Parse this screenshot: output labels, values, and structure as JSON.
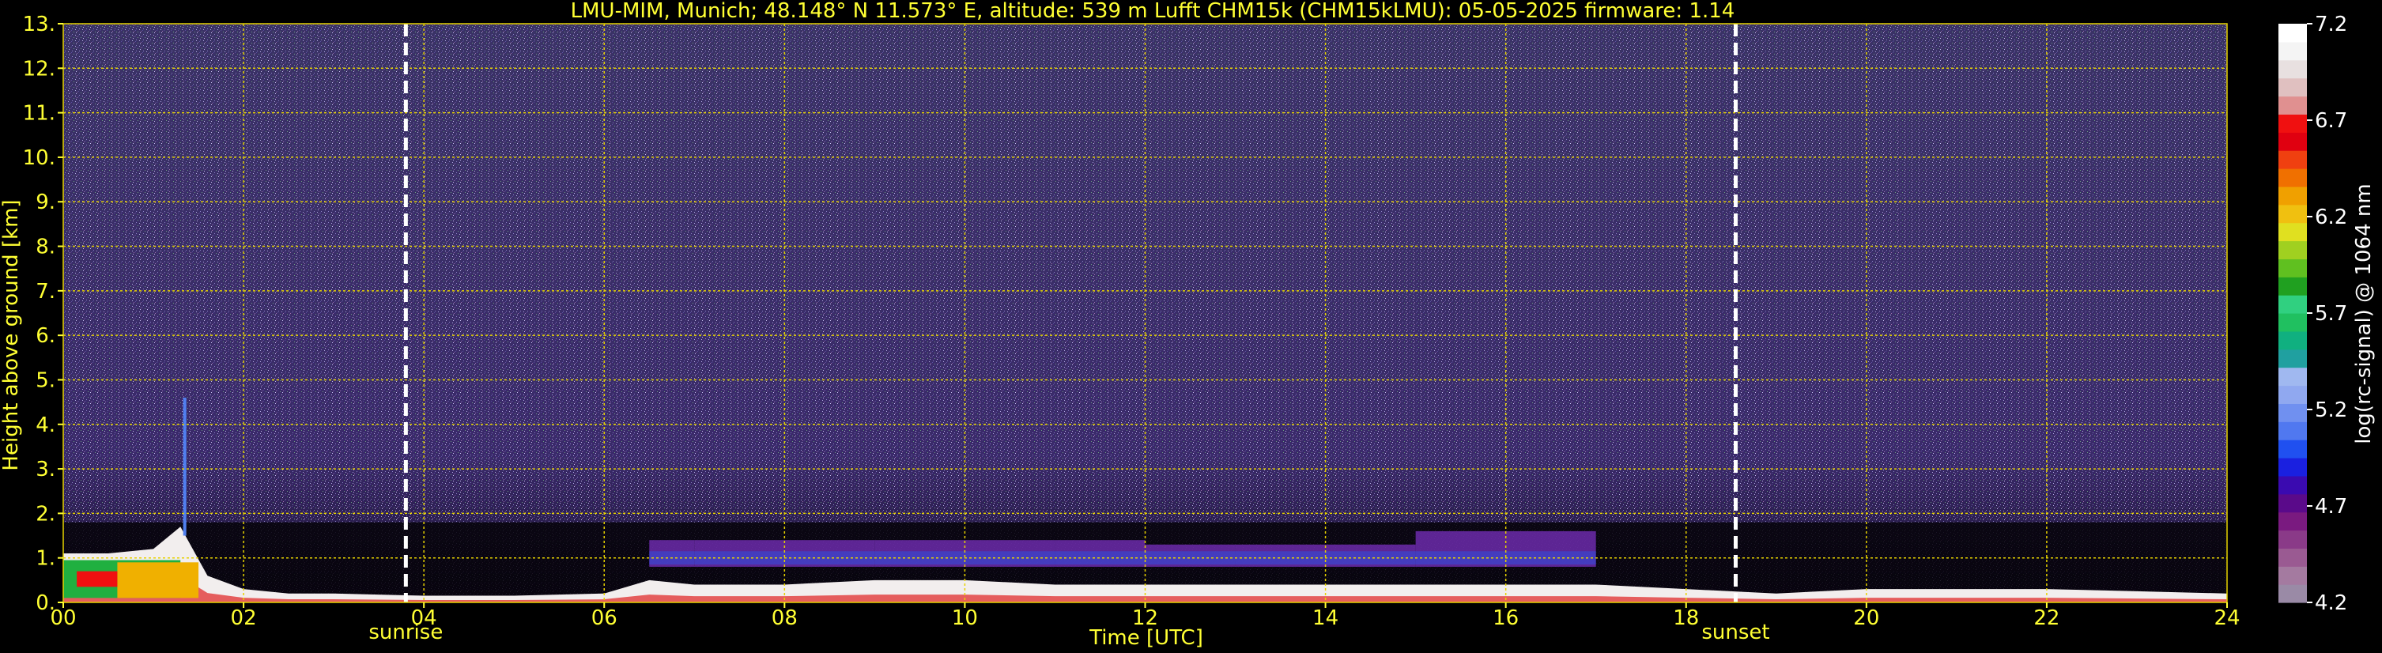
{
  "chart_data": {
    "type": "heatmap",
    "title": "LMU-MIM, Munich; 48.148° N 11.573° E, altitude: 539 m    Lufft CHM15k (CHM15kLMU): 05-05-2025    firmware: 1.14",
    "xlabel": "Time [UTC]",
    "ylabel": "Height above ground [km]",
    "xlim": [
      0,
      24
    ],
    "ylim": [
      0,
      13
    ],
    "x_ticks": [
      "00",
      "02",
      "04",
      "06",
      "08",
      "10",
      "12",
      "14",
      "16",
      "18",
      "20",
      "22",
      "24"
    ],
    "y_ticks": [
      "0.",
      "1.",
      "2.",
      "3.",
      "4.",
      "5.",
      "6.",
      "7.",
      "8.",
      "9.",
      "10.",
      "11.",
      "12.",
      "13."
    ],
    "grid": true,
    "events": [
      {
        "name": "sunrise",
        "time": 3.8
      },
      {
        "name": "sunset",
        "time": 18.55
      }
    ],
    "colorbar": {
      "label": "log(rc-signal) @ 1064 nm",
      "range": [
        4.2,
        7.2
      ],
      "ticks": [
        "4.2",
        "4.7",
        "5.2",
        "5.7",
        "6.2",
        "6.7",
        "7.2"
      ],
      "colors": [
        "#9a8aa6",
        "#a47aa0",
        "#9a5a92",
        "#8a3a88",
        "#7a1a80",
        "#5a0a8a",
        "#3a0ab0",
        "#1a20e0",
        "#2050f0",
        "#5078f0",
        "#7090f0",
        "#90a8f0",
        "#a0b8f0",
        "#20a0a0",
        "#10b080",
        "#20c060",
        "#30d080",
        "#20a020",
        "#60c020",
        "#a0d020",
        "#e0e020",
        "#f0c010",
        "#f0a000",
        "#f07000",
        "#f04010",
        "#e00010",
        "#f01010",
        "#e09090",
        "#e0c0c0",
        "#e8e0e0",
        "#f4f4f4",
        "#ffffff"
      ]
    },
    "signal_profile": {
      "description_time_hours": [
        0,
        0.5,
        1.0,
        1.3,
        1.6,
        2.0,
        2.5,
        3.0,
        4.0,
        5.0,
        6.0,
        6.5,
        7.0,
        8.0,
        9.0,
        10.0,
        11.0,
        12.0,
        13.0,
        14.0,
        15.0,
        16.0,
        17.0,
        18.0,
        19.0,
        20.0,
        21.0,
        22.0,
        23.0,
        24.0
      ],
      "boundary_layer_top_km": [
        1.1,
        1.1,
        1.2,
        1.7,
        0.6,
        0.3,
        0.2,
        0.2,
        0.15,
        0.15,
        0.2,
        0.5,
        0.4,
        0.4,
        0.5,
        0.5,
        0.4,
        0.4,
        0.4,
        0.4,
        0.4,
        0.4,
        0.4,
        0.3,
        0.2,
        0.3,
        0.3,
        0.3,
        0.25,
        0.2
      ],
      "aerosol_layer_top_km": [
        0,
        0,
        0,
        0,
        0,
        0,
        0,
        0,
        0,
        0,
        0,
        1.4,
        1.4,
        1.3,
        1.4,
        1.4,
        1.4,
        1.3,
        1.3,
        1.3,
        1.2,
        1.6,
        1.1,
        0,
        0,
        0,
        0,
        0,
        0,
        0
      ]
    }
  }
}
